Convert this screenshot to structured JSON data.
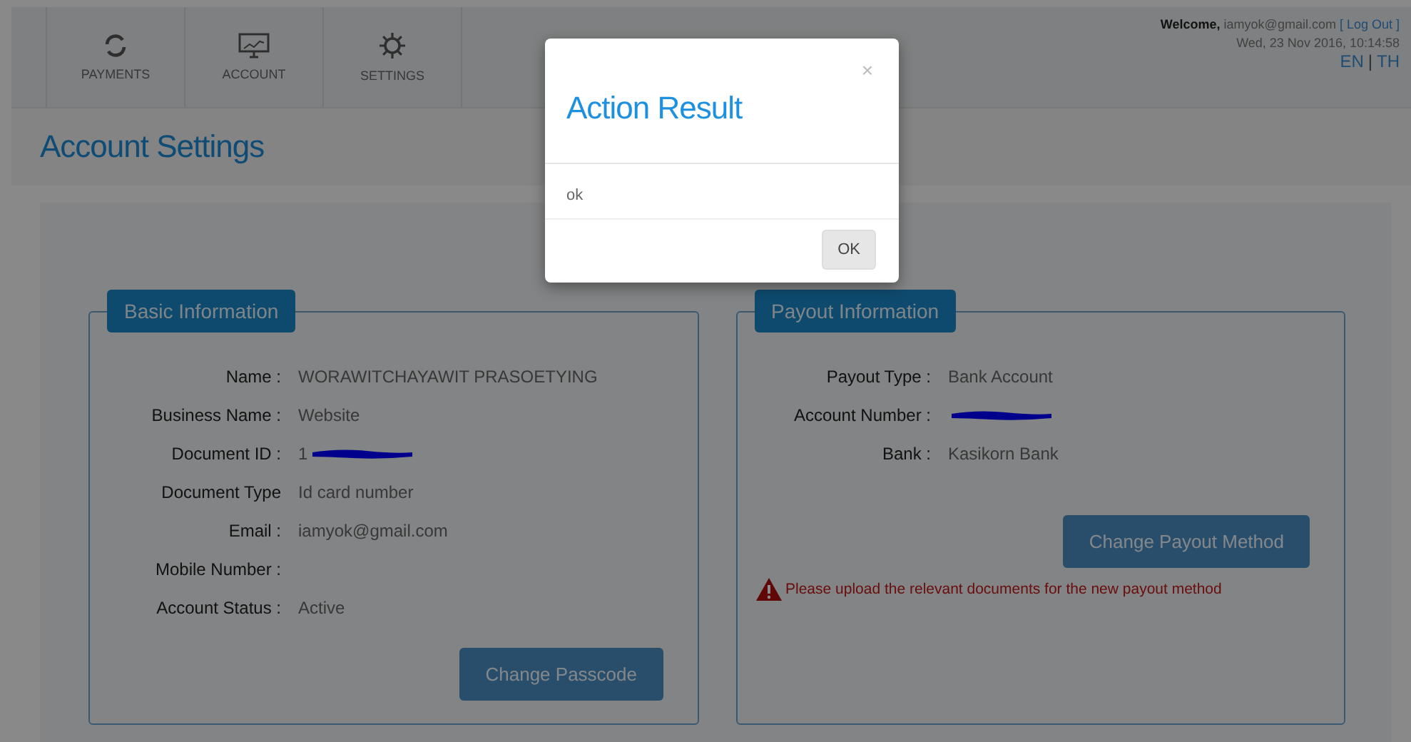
{
  "nav": [
    {
      "label": "PAYMENTS"
    },
    {
      "label": "ACCOUNT"
    },
    {
      "label": "SETTINGS"
    }
  ],
  "user": {
    "welcome": "Welcome,",
    "email": "iamyok@gmail.com",
    "logout_open": "[",
    "logout": "Log Out",
    "logout_close": "]",
    "datetime": "Wed, 23 Nov 2016, 10:14:58",
    "languages": [
      "EN",
      "TH"
    ],
    "language_separator": "|"
  },
  "page_title": "Account Settings",
  "panels": [
    {
      "title": "Basic Information",
      "fields": [
        {
          "label": "Name :",
          "value": "WORAWITCHAYAWIT PRASOETYING"
        },
        {
          "label": "Business Name :",
          "value": "Website"
        },
        {
          "label": "Document ID :",
          "value": "1",
          "redacted": true
        },
        {
          "label": "Document Type",
          "value": "Id card number"
        },
        {
          "label": "Email :",
          "value": "iamyok@gmail.com"
        },
        {
          "label": "Mobile Number :"
        },
        {
          "label": "Account Status :",
          "value": "Active"
        }
      ],
      "button": "Change Passcode"
    },
    {
      "title": "Payout Information",
      "fields": [
        {
          "label": "Payout Type :",
          "value": "Bank Account"
        },
        {
          "label": "Account Number :",
          "redacted": true
        },
        {
          "label": "Bank :",
          "value": "Kasikorn Bank"
        }
      ],
      "button": "Change Payout Method",
      "warning": "Please upload the relevant documents for the new payout method"
    }
  ],
  "dialog": {
    "close": "×",
    "title": "Action Result",
    "message": "ok",
    "button": "OK"
  }
}
